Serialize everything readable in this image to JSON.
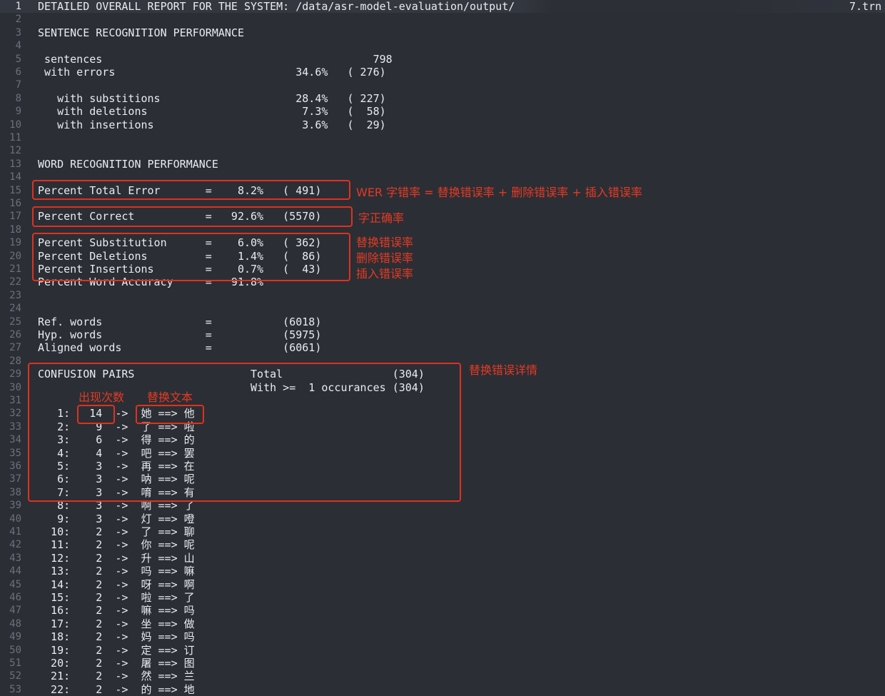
{
  "header_tail": "7.trn",
  "lines": [
    {
      "n": "1",
      "t": "DETAILED OVERALL REPORT FOR THE SYSTEM: /data/asr-model-evaluation/output/"
    },
    {
      "n": "2",
      "t": ""
    },
    {
      "n": "3",
      "t": "SENTENCE RECOGNITION PERFORMANCE"
    },
    {
      "n": "4",
      "t": ""
    },
    {
      "n": "5",
      "t": " sentences                                          798"
    },
    {
      "n": "6",
      "t": " with errors                            34.6%   ( 276)"
    },
    {
      "n": "7",
      "t": ""
    },
    {
      "n": "8",
      "t": "   with substitions                     28.4%   ( 227)"
    },
    {
      "n": "9",
      "t": "   with deletions                        7.3%   (  58)"
    },
    {
      "n": "10",
      "t": "   with insertions                       3.6%   (  29)"
    },
    {
      "n": "11",
      "t": ""
    },
    {
      "n": "12",
      "t": ""
    },
    {
      "n": "13",
      "t": "WORD RECOGNITION PERFORMANCE"
    },
    {
      "n": "14",
      "t": ""
    },
    {
      "n": "15",
      "t": "Percent Total Error       =    8.2%   ( 491)"
    },
    {
      "n": "16",
      "t": ""
    },
    {
      "n": "17",
      "t": "Percent Correct           =   92.6%   (5570)"
    },
    {
      "n": "18",
      "t": ""
    },
    {
      "n": "19",
      "t": "Percent Substitution      =    6.0%   ( 362)"
    },
    {
      "n": "20",
      "t": "Percent Deletions         =    1.4%   (  86)"
    },
    {
      "n": "21",
      "t": "Percent Insertions        =    0.7%   (  43)"
    },
    {
      "n": "22",
      "t": "Percent Word Accuracy     =   91.8%"
    },
    {
      "n": "23",
      "t": ""
    },
    {
      "n": "24",
      "t": ""
    },
    {
      "n": "25",
      "t": "Ref. words                =           (6018)"
    },
    {
      "n": "26",
      "t": "Hyp. words                =           (5975)"
    },
    {
      "n": "27",
      "t": "Aligned words             =           (6061)"
    },
    {
      "n": "28",
      "t": ""
    },
    {
      "n": "29",
      "t": "CONFUSION PAIRS                  Total                 (304)"
    },
    {
      "n": "30",
      "t": "                                 With >=  1 occurances (304)"
    },
    {
      "n": "31",
      "t": ""
    },
    {
      "n": "32",
      "t": "   1:   14  ->  她 ==> 他"
    },
    {
      "n": "33",
      "t": "   2:    9  ->  了 ==> 啦"
    },
    {
      "n": "34",
      "t": "   3:    6  ->  得 ==> 的"
    },
    {
      "n": "35",
      "t": "   4:    4  ->  吧 ==> 罢"
    },
    {
      "n": "36",
      "t": "   5:    3  ->  再 ==> 在"
    },
    {
      "n": "37",
      "t": "   6:    3  ->  呐 ==> 呢"
    },
    {
      "n": "38",
      "t": "   7:    3  ->  唷 ==> 有"
    },
    {
      "n": "39",
      "t": "   8:    3  ->  啊 ==> 了"
    },
    {
      "n": "40",
      "t": "   9:    3  ->  灯 ==> 噔"
    },
    {
      "n": "41",
      "t": "  10:    2  ->  了 ==> 聊"
    },
    {
      "n": "42",
      "t": "  11:    2  ->  你 ==> 呢"
    },
    {
      "n": "43",
      "t": "  12:    2  ->  升 ==> 山"
    },
    {
      "n": "44",
      "t": "  13:    2  ->  吗 ==> 嘛"
    },
    {
      "n": "45",
      "t": "  14:    2  ->  呀 ==> 啊"
    },
    {
      "n": "46",
      "t": "  15:    2  ->  啦 ==> 了"
    },
    {
      "n": "47",
      "t": "  16:    2  ->  嘛 ==> 吗"
    },
    {
      "n": "48",
      "t": "  17:    2  ->  坐 ==> 做"
    },
    {
      "n": "49",
      "t": "  18:    2  ->  妈 ==> 吗"
    },
    {
      "n": "50",
      "t": "  19:    2  ->  定 ==> 订"
    },
    {
      "n": "51",
      "t": "  20:    2  ->  屠 ==> 图"
    },
    {
      "n": "52",
      "t": "  21:    2  ->  然 ==> 兰"
    },
    {
      "n": "53",
      "t": "  22:    2  ->  的 ==> 地"
    }
  ],
  "annotations": {
    "wer": "WER 字错率 = 替换错误率 + 删除错误率 + 插入错误率",
    "correct": "字正确率",
    "substitution": "替换错误率",
    "deletion": "删除错误率",
    "insertion": "插入错误率",
    "confusion_detail": "替换错误详情",
    "occurrences": "出现次数",
    "replacement_text": "替换文本"
  },
  "colors": {
    "background": "#2b2e35",
    "annotation": "#e0311e",
    "text": "#e9ecef",
    "line_number": "#6b717c"
  }
}
